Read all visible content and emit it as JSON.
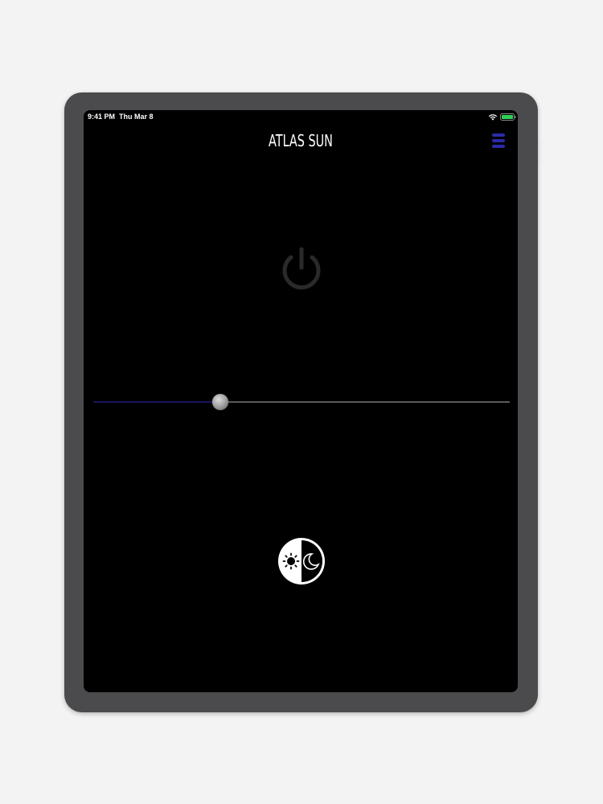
{
  "status_bar": {
    "time": "9:41 PM",
    "date": "Thu Mar 8",
    "wifi_icon": "wifi-icon",
    "battery_icon": "battery-icon",
    "battery_color": "#30d158"
  },
  "header": {
    "title": "ATLAS SUN",
    "menu_icon": "hamburger-menu-icon",
    "menu_color": "#2c2aa8"
  },
  "controls": {
    "power_icon": "power-icon",
    "power_color": "#2a2a2a",
    "brightness_level": 0.305,
    "slider_min_color": "#17175e",
    "slider_max_color": "#5a5a5a",
    "day_night_icon": "day-night-toggle-icon"
  }
}
